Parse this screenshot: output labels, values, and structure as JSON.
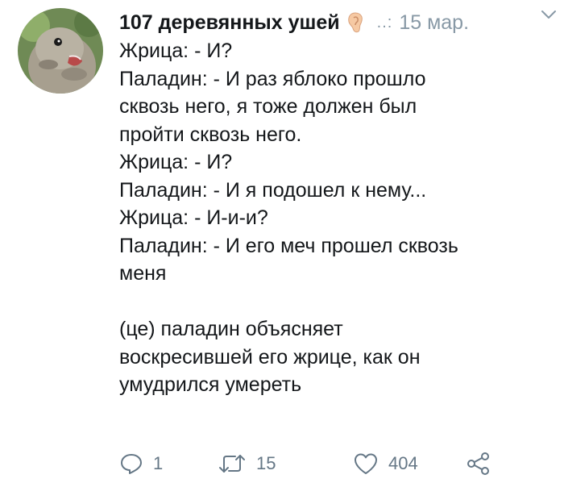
{
  "tweet": {
    "author_name": "107 деревянных ушей",
    "author_emoji": "ear-icon",
    "handle": "..:",
    "date": "15 мар.",
    "text_lines": [
      "Жрица: - И?",
      "Паладин: - И раз яблоко прошло",
      "сквозь него, я тоже должен был",
      "пройти сквозь него.",
      "Жрица: - И?",
      "Паладин: - И я подошел к нему...",
      "Жрица: - И-и-и?",
      "Паладин: - И его меч прошел сквозь",
      "меня",
      "",
      "(це) паладин объясняет",
      "воскресившей его жрице, как он",
      "умудрился умереть"
    ],
    "actions": {
      "reply_count": "1",
      "retweet_count": "15",
      "like_count": "404"
    }
  },
  "colors": {
    "text": "#14171a",
    "muted": "#8899a6",
    "action": "#657786"
  }
}
